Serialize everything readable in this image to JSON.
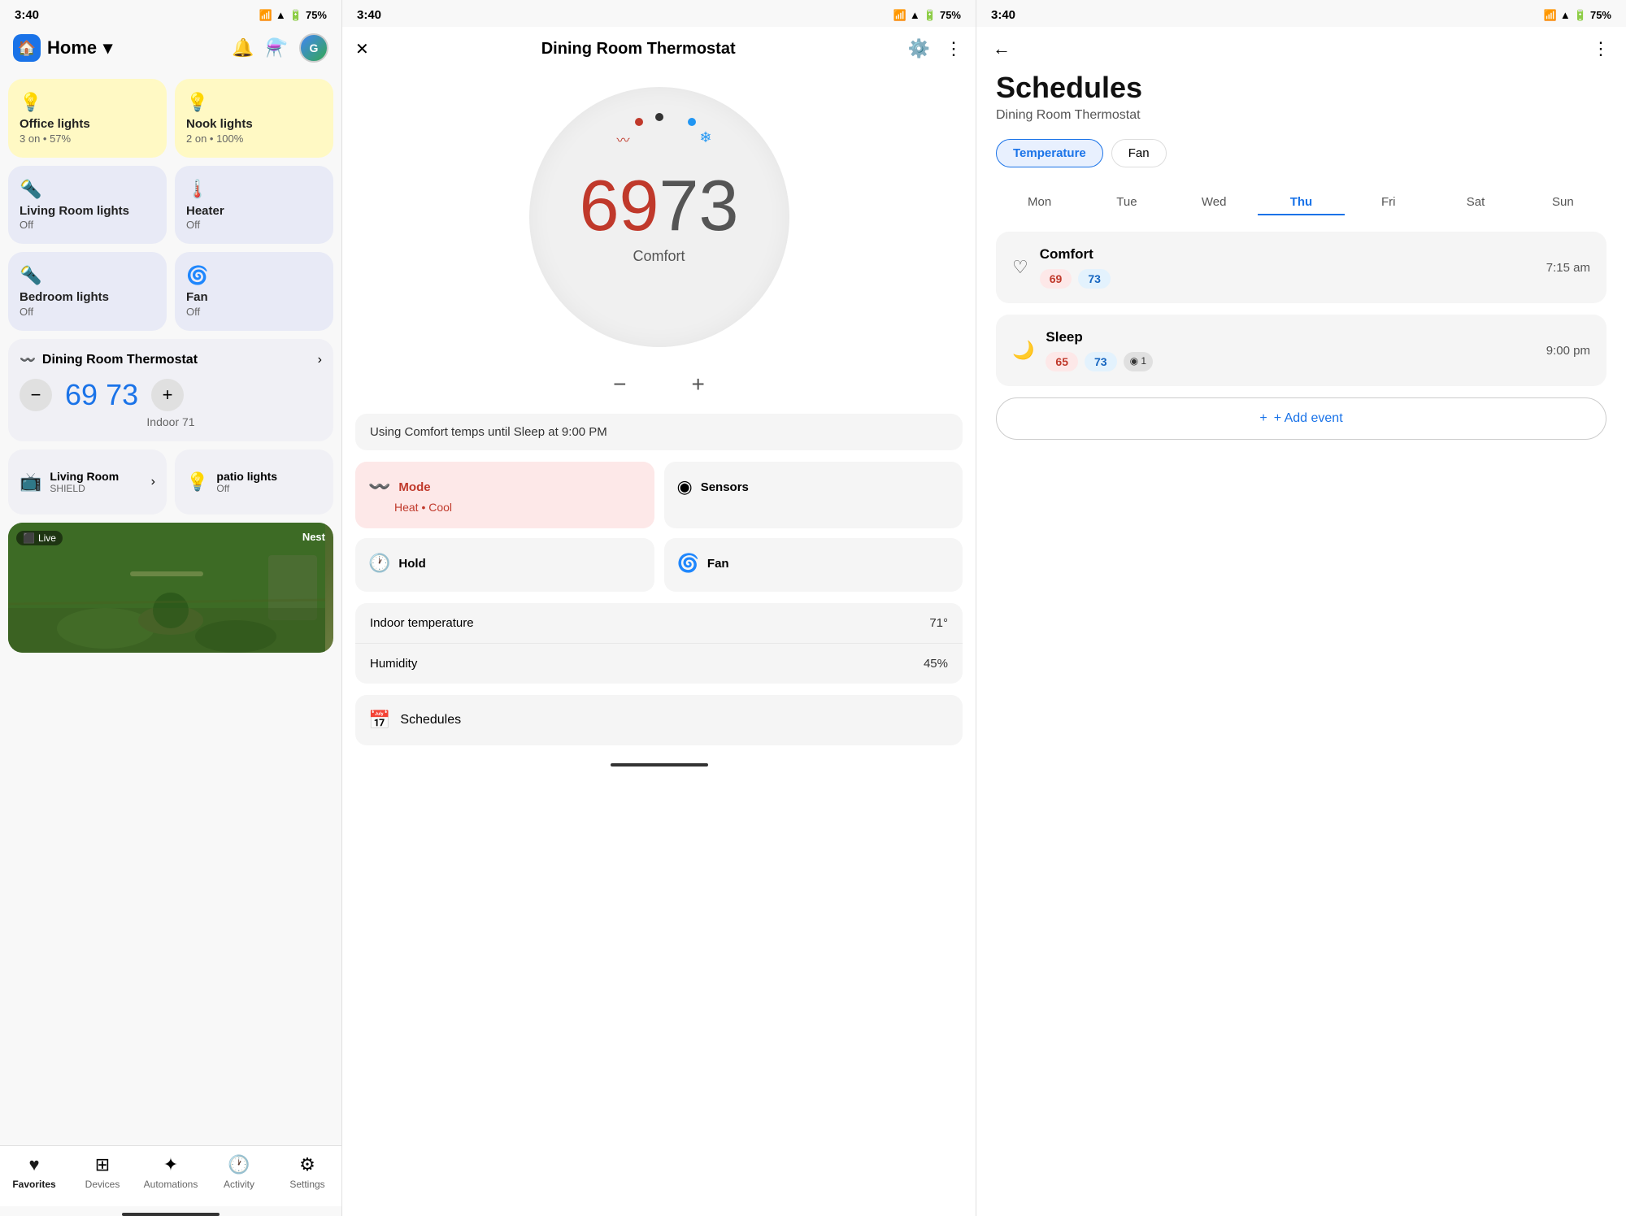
{
  "panel1": {
    "statusBar": {
      "time": "3:40",
      "battery": "75%"
    },
    "header": {
      "title": "Home",
      "chevron": "▾"
    },
    "activeCards": [
      {
        "name": "Office lights",
        "status": "3 on • 57%",
        "active": true,
        "icon": "💡"
      },
      {
        "name": "Nook lights",
        "status": "2 on • 100%",
        "active": true,
        "icon": "💡"
      }
    ],
    "inactiveCards": [
      {
        "name": "Living Room lights",
        "status": "Off",
        "icon": "🔦",
        "col": 0
      },
      {
        "name": "Heater",
        "status": "Off",
        "icon": "🌡️",
        "col": 1
      },
      {
        "name": "Bedroom lights",
        "status": "Off",
        "icon": "🔦",
        "col": 0
      },
      {
        "name": "Fan",
        "status": "Off",
        "icon": "🌀",
        "col": 1
      }
    ],
    "thermostat": {
      "name": "Dining Room Thermostat",
      "currentTemp": "69",
      "setTemp": "73",
      "indoorLabel": "Indoor 71"
    },
    "shield": {
      "name": "Living Room",
      "subtitle": "SHIELD",
      "icon": "📺"
    },
    "patioLights": {
      "name": "patio lights",
      "status": "Off",
      "icon": "💡"
    },
    "camera": {
      "live": "Live",
      "brand": "Nest"
    },
    "nav": [
      {
        "label": "Favorites",
        "icon": "♥",
        "active": true
      },
      {
        "label": "Devices",
        "icon": "⊞",
        "active": false
      },
      {
        "label": "Automations",
        "icon": "✦",
        "active": false
      },
      {
        "label": "Activity",
        "icon": "🕐",
        "active": false
      },
      {
        "label": "Settings",
        "icon": "⚙",
        "active": false
      }
    ]
  },
  "panel2": {
    "statusBar": {
      "time": "3:40",
      "battery": "75%"
    },
    "header": {
      "title": "Dining Room Thermostat",
      "closeIcon": "✕"
    },
    "dial": {
      "currentTemp": "69",
      "setTemp": "73",
      "label": "Comfort"
    },
    "comfortMsg": "Using Comfort temps until Sleep at 9:00 PM",
    "tiles": [
      {
        "id": "mode",
        "icon": "🔥",
        "title": "Mode",
        "subtitle": "Heat • Cool",
        "active": true
      },
      {
        "id": "sensors",
        "icon": "◉",
        "title": "Sensors",
        "subtitle": "",
        "active": false
      },
      {
        "id": "hold",
        "icon": "🕐",
        "title": "Hold",
        "subtitle": "",
        "active": false
      },
      {
        "id": "fan",
        "icon": "🌀",
        "title": "Fan",
        "subtitle": "",
        "active": false
      }
    ],
    "infoRows": [
      {
        "label": "Indoor temperature",
        "value": "71°"
      },
      {
        "label": "Humidity",
        "value": "45%"
      }
    ],
    "schedulesTile": "Schedules"
  },
  "panel3": {
    "statusBar": {
      "time": "3:40",
      "battery": "75%"
    },
    "title": "Schedules",
    "subtitle": "Dining Room Thermostat",
    "tabs": [
      {
        "label": "Temperature",
        "active": true
      },
      {
        "label": "Fan",
        "active": false
      }
    ],
    "days": [
      {
        "label": "Mon",
        "active": false
      },
      {
        "label": "Tue",
        "active": false
      },
      {
        "label": "Wed",
        "active": false
      },
      {
        "label": "Thu",
        "active": true
      },
      {
        "label": "Fri",
        "active": false
      },
      {
        "label": "Sat",
        "active": false
      },
      {
        "label": "Sun",
        "active": false
      }
    ],
    "events": [
      {
        "id": "comfort",
        "icon": "♡",
        "name": "Comfort",
        "heatTemp": "69",
        "coolTemp": "73",
        "extra": null,
        "time": "7:15 am"
      },
      {
        "id": "sleep",
        "icon": "🌙",
        "name": "Sleep",
        "heatTemp": "65",
        "coolTemp": "73",
        "extra": "◉ 1",
        "time": "9:00 pm"
      }
    ],
    "addEventLabel": "+ Add event"
  }
}
